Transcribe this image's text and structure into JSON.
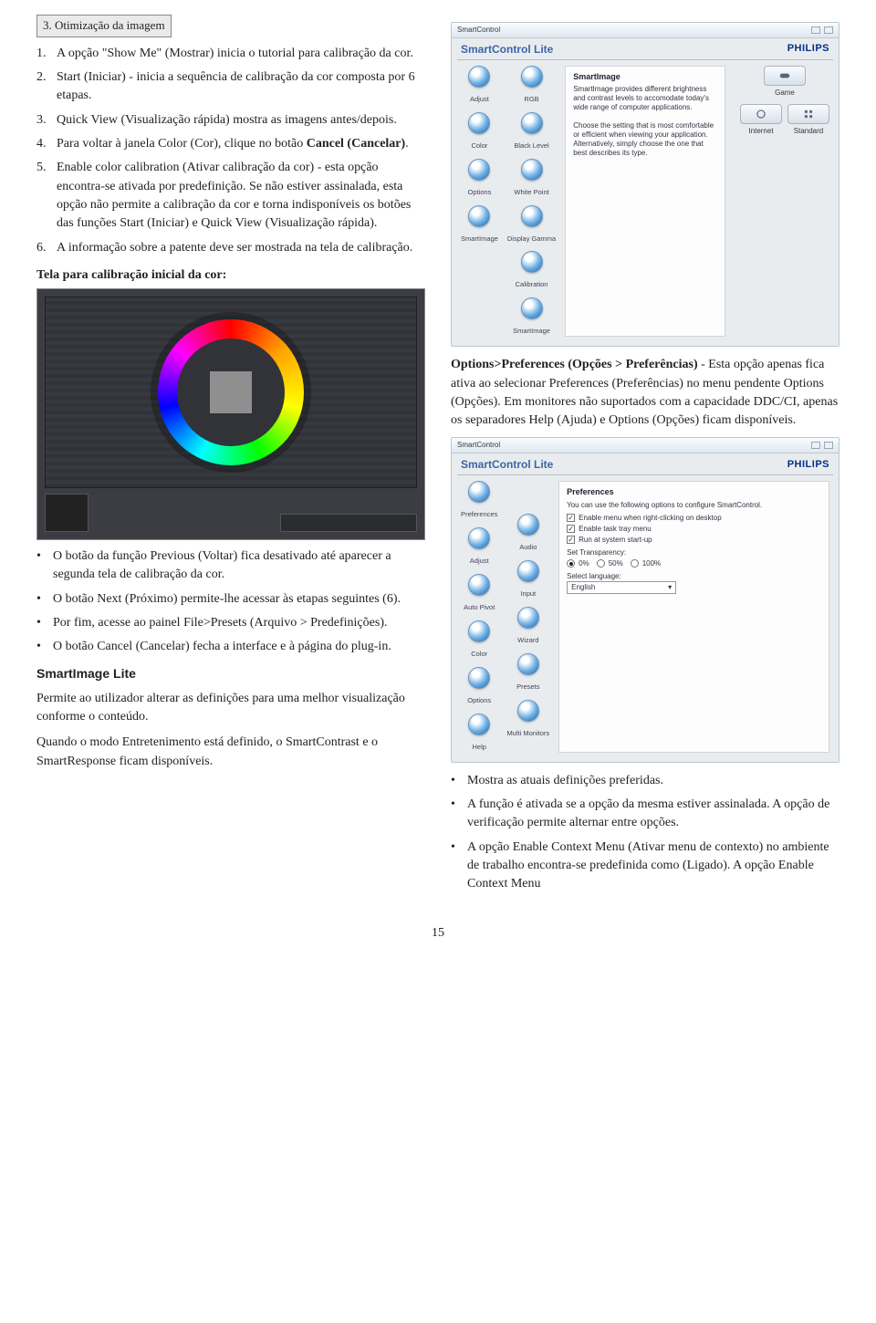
{
  "header": {
    "section_label": "3. Otimização da imagem"
  },
  "left": {
    "steps": [
      "A opção \"Show Me\" (Mostrar) inicia o tutorial para calibração da cor.",
      "Start (Iniciar) - inicia a sequência de calibração da cor composta por 6 etapas.",
      "Quick View (Visualização rápida) mostra as imagens antes/depois.",
      "Para voltar à janela Color (Cor), clique no botão Cancel (Cancelar).",
      "Enable color calibration (Ativar calibração da cor) - esta opção encontra-se ativada por predefinição. Se não estiver assinalada, esta opção não permite a calibração da cor e torna indisponíveis os botões das funções Start (Iniciar) e Quick View (Visualização rápida).",
      "A informação sobre a patente deve ser mostrada na tela de calibração."
    ],
    "calib_heading": "Tela para calibração inicial da cor:",
    "bullets1": [
      "O botão da função Previous (Voltar) fica desativado até aparecer a segunda tela de calibração da cor.",
      "O botão Next (Próximo) permite-lhe acessar às etapas seguintes (6).",
      "Por fim, acesse ao painel File>Presets (Arquivo > Predefinições).",
      "O botão Cancel (Cancelar) fecha a interface e à página do plug-in."
    ],
    "sil_head": "SmartImage Lite",
    "sil_p1": "Permite ao utilizador alterar as definições para uma melhor visualização conforme o conteúdo.",
    "sil_p2": "Quando o modo Entretenimento está definido, o SmartContrast e o SmartResponse ficam disponíveis."
  },
  "right": {
    "p1": "Options>Preferences (Opções > Preferências) - Esta opção apenas fica ativa ao selecionar Preferences (Preferências) no menu pendente Options (Opções). Em monitores não suportados com a capacidade DDC/CI, apenas os separadores Help (Ajuda) e Options (Opções) ficam disponíveis.",
    "p1_lead": "Options>Preferences (Opções > Preferências)",
    "bullets": [
      "Mostra as atuais definições preferidas.",
      "A função é ativada se a opção da mesma estiver assinalada. A opção de verificação permite alternar entre opções.",
      "A opção Enable Context Menu (Ativar menu de contexto) no ambiente de trabalho encontra-se predefinida como (Ligado). A opção Enable Context Menu"
    ]
  },
  "scr1": {
    "winlabel": "SmartControl",
    "brand": "SmartControl Lite",
    "philips": "PHILIPS",
    "panel_title": "SmartImage",
    "panel_body": "SmartImage provides different brightness and contrast levels to accomodate today's wide range of computer applications.\n\nChoose the setting that is most comfortable or efficient when viewing your application. Alternatively, simply choose the one that best describes its type.",
    "cols": [
      [
        "Adjust",
        "Color",
        "Options",
        "SmartImage"
      ],
      [
        "RGB",
        "Black Level",
        "White Point",
        "Display Gamma",
        "Calibration",
        "SmartImage"
      ]
    ],
    "buttons": [
      {
        "icon": "gamepad",
        "label": "Game"
      },
      {
        "icon": "globe",
        "label": "Internet"
      },
      {
        "icon": "grid",
        "label": "Standard"
      }
    ]
  },
  "scr2": {
    "winlabel": "SmartControl",
    "brand": "SmartControl Lite",
    "philips": "PHILIPS",
    "panel_title": "Preferences",
    "panel_intro": "You can use the following options to configure SmartControl.",
    "checks": [
      "Enable menu when right-clicking on desktop",
      "Enable task tray menu",
      "Run at system start-up"
    ],
    "transp_label": "Set Transparency:",
    "radios": [
      "0%",
      "50%",
      "100%"
    ],
    "lang_label": "Select language:",
    "lang_value": "English",
    "cols": [
      [
        "Adjust",
        "Auto Pivot",
        "Color",
        "Options",
        "Help"
      ],
      [
        "Audio",
        "Input",
        "Wizard",
        "Presets",
        "Multi Monitors"
      ]
    ]
  },
  "page_number": "15"
}
